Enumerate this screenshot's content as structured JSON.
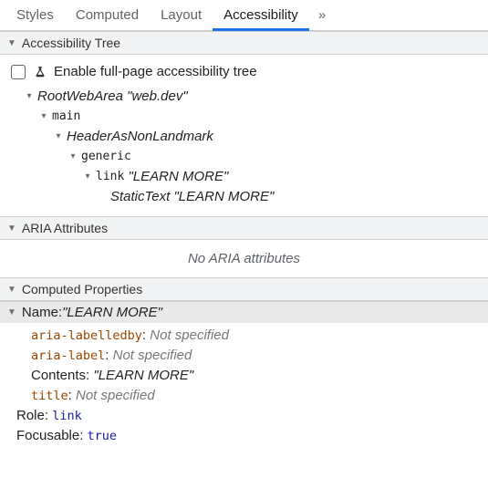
{
  "tabs": {
    "styles": "Styles",
    "computed": "Computed",
    "layout": "Layout",
    "accessibility": "Accessibility",
    "more": "»"
  },
  "sections": {
    "tree_header": "Accessibility Tree",
    "aria_header": "ARIA Attributes",
    "computed_header": "Computed Properties"
  },
  "enable": {
    "label": "Enable full-page accessibility tree"
  },
  "tree": {
    "root_role": "RootWebArea",
    "root_name": "\"web.dev\"",
    "main": "main",
    "header": "HeaderAsNonLandmark",
    "generic": "generic",
    "link_role": "link",
    "link_name": "\"LEARN MORE\"",
    "static_role": "StaticText",
    "static_name": "\"LEARN MORE\""
  },
  "aria": {
    "empty": "No ARIA attributes"
  },
  "computed": {
    "name_label": "Name: ",
    "name_value": "\"LEARN MORE\"",
    "aria_labelledby": "aria-labelledby",
    "aria_label": "aria-label",
    "not_specified": "Not specified",
    "contents_label": "Contents: ",
    "contents_value": "\"LEARN MORE\"",
    "title": "title",
    "role_label": "Role: ",
    "role_value": "link",
    "focusable_label": "Focusable: ",
    "focusable_value": "true",
    "sep": ": "
  }
}
